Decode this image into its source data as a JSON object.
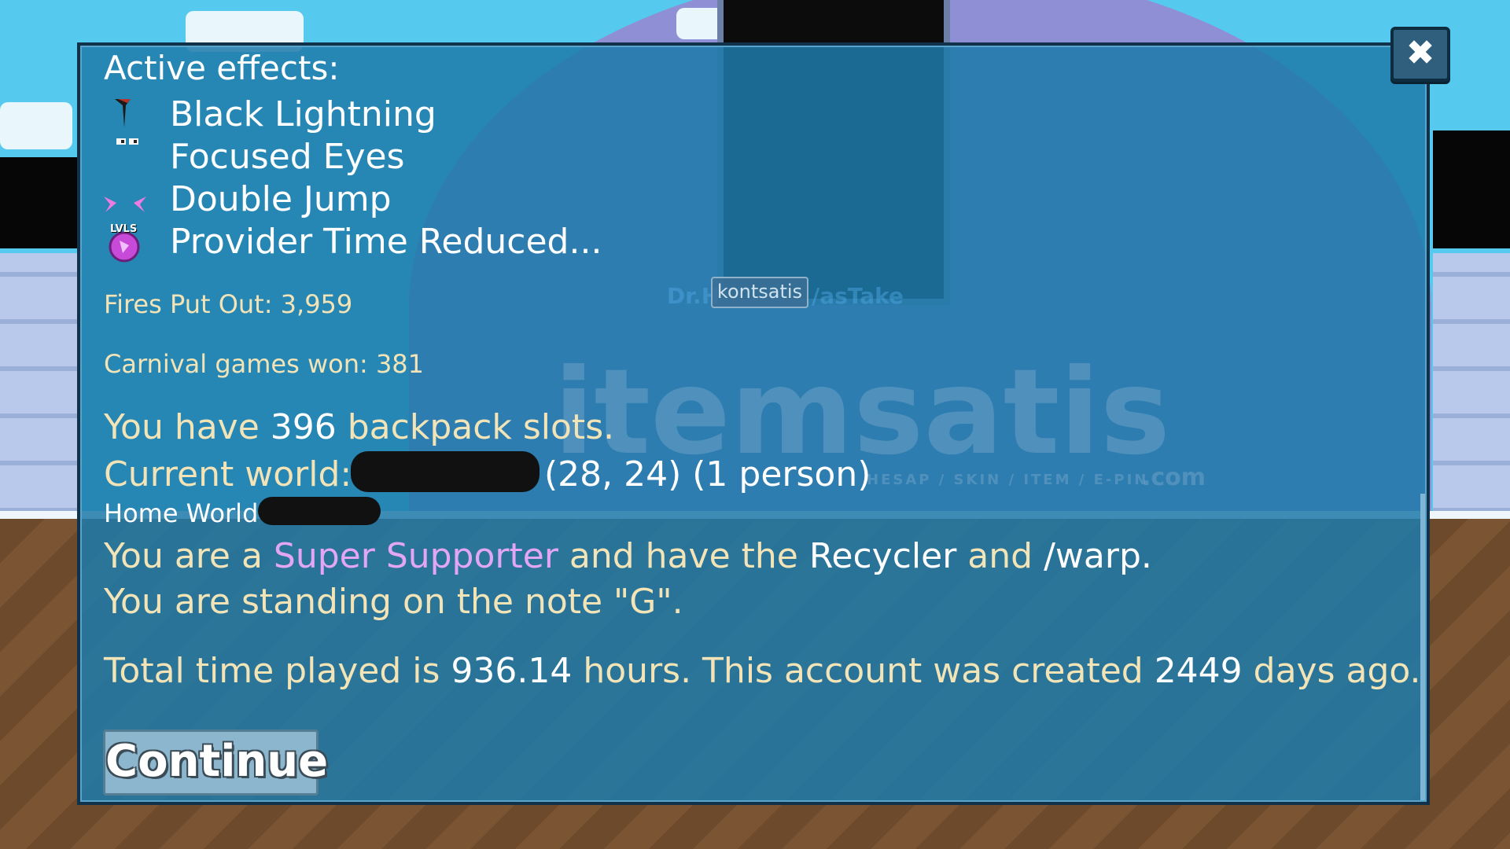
{
  "panel": {
    "effects_heading": "Active effects:",
    "effects": [
      {
        "label": "Black Lightning",
        "icon": "black-lightning-icon"
      },
      {
        "label": "Focused Eyes",
        "icon": "focused-eyes-icon"
      },
      {
        "label": "Double Jump",
        "icon": "double-jump-icon"
      },
      {
        "label": "Provider Time Reduced...",
        "icon": "lvls-badge-icon",
        "icon_text": "LVLS"
      }
    ],
    "fires_put_out": "Fires Put Out: 3,959",
    "carnival_games": "Carnival games won: 381",
    "backpack": {
      "pre": "You have ",
      "value": "396",
      "post": " backpack slots."
    },
    "current_world": {
      "label": "Current world:",
      "coords": "(28, 24) (1 person)"
    },
    "home_world": {
      "label": "Home World"
    },
    "supporter": {
      "pre": "You are a ",
      "rank": "Super Supporter",
      "mid": " and have the ",
      "item": "Recycler",
      "and": " and ",
      "cmd": "/warp."
    },
    "standing": "You are standing on the note \"G\".",
    "time": {
      "pre": "Total time played is ",
      "hours": "936.14",
      "mid": " hours.  This account was created ",
      "days": "2449",
      "post": " days ago."
    },
    "continue_label": "Continue",
    "close_label": "✖"
  },
  "world": {
    "player_name": "kontsatis",
    "other_name_left": "Dr.H",
    "other_name_right": "/asTake",
    "watermark": "itemsatis",
    "watermark_tagline": "HESAP / SKIN / ITEM / E-PIN",
    "watermark_suffix": ".com"
  },
  "colors": {
    "panel_bg": "#1e7aaa",
    "text_cream": "#f3e4b7",
    "text_white": "#ffffff",
    "supporter_pink": "#e2a6f3"
  }
}
